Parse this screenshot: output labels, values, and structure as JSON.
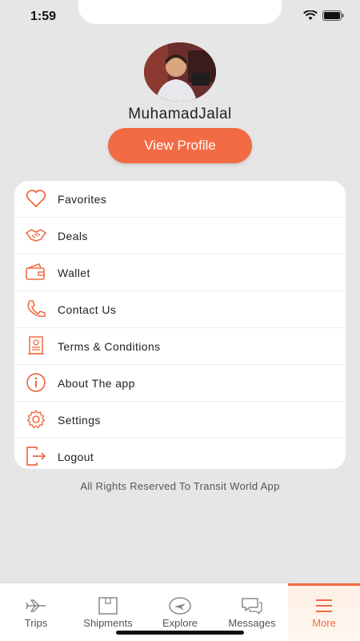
{
  "status": {
    "time": "1:59"
  },
  "profile": {
    "name": "MuhamadJalal",
    "view_profile_label": "View Profile"
  },
  "menu": [
    {
      "label": "Favorites",
      "icon": "heart-icon"
    },
    {
      "label": "Deals",
      "icon": "handshake-icon"
    },
    {
      "label": "Wallet",
      "icon": "wallet-icon"
    },
    {
      "label": "Contact Us",
      "icon": "phone-icon"
    },
    {
      "label": "Terms & Conditions",
      "icon": "document-icon"
    },
    {
      "label": "About The app",
      "icon": "info-icon"
    },
    {
      "label": "Settings",
      "icon": "gear-icon"
    },
    {
      "label": "Logout",
      "icon": "logout-icon"
    }
  ],
  "footer": {
    "text": "All Rights Reserved To Transit World App"
  },
  "tabs": [
    {
      "label": "Trips",
      "icon": "plane-icon",
      "active": false
    },
    {
      "label": "Shipments",
      "icon": "box-icon",
      "active": false
    },
    {
      "label": "Explore",
      "icon": "globe-plane-icon",
      "active": false
    },
    {
      "label": "Messages",
      "icon": "chat-icon",
      "active": false
    },
    {
      "label": "More",
      "icon": "menu-icon",
      "active": true
    }
  ],
  "colors": {
    "accent": "#f26b44",
    "background": "#e6e6e6",
    "card": "#ffffff"
  }
}
